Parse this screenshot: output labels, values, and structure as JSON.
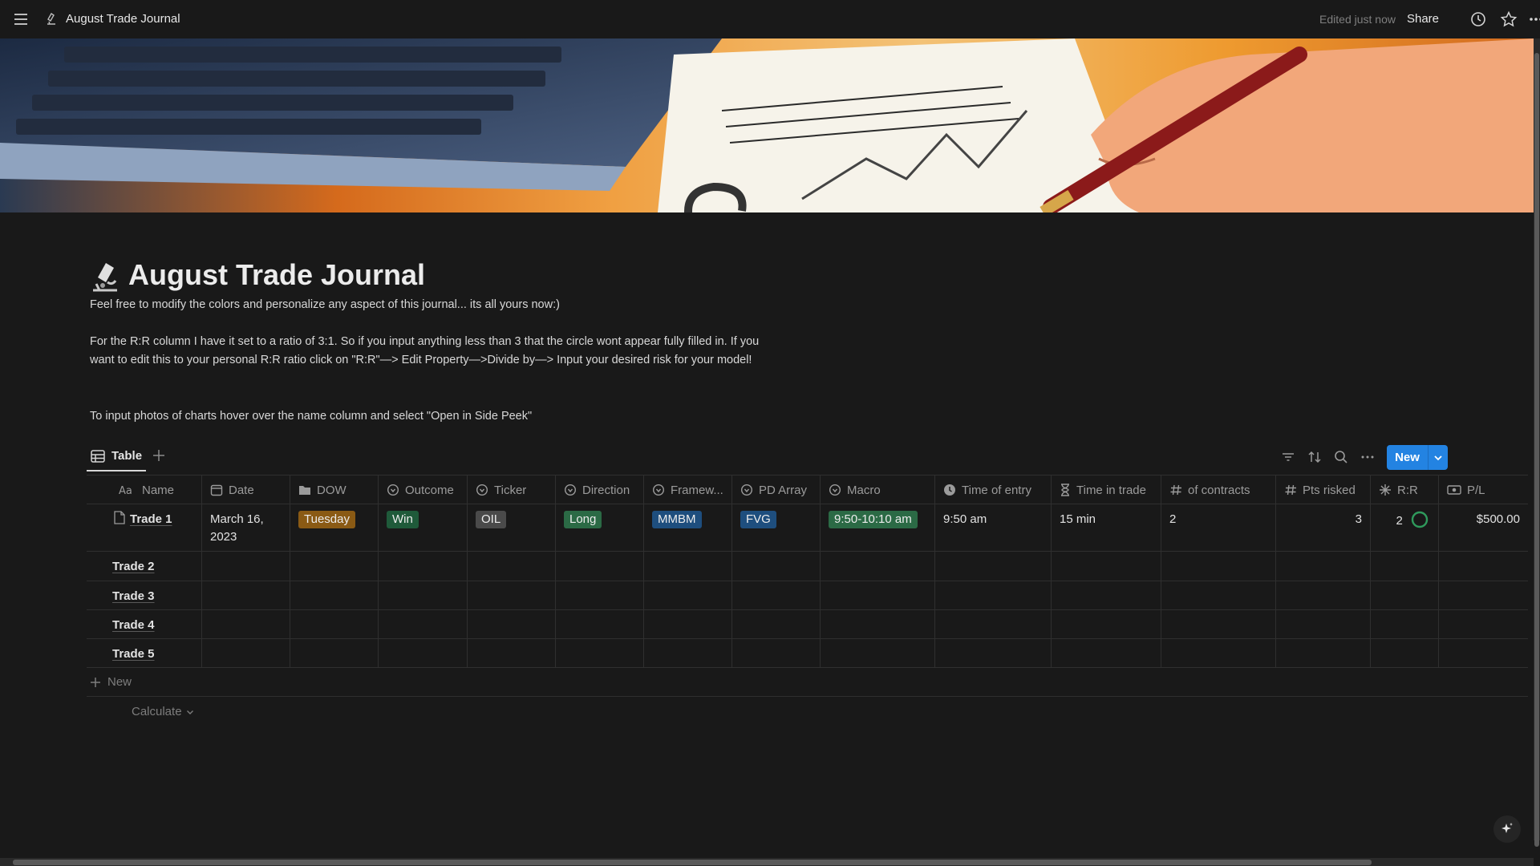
{
  "topbar": {
    "title": "August Trade Journal",
    "edited": "Edited just now",
    "share": "Share"
  },
  "page": {
    "title": "August Trade Journal",
    "desc": [
      "Feel free to modify the colors and personalize any aspect of this journal... its all yours now:)",
      "For the R:R column I have it set to a ratio of 3:1. So if you input anything less than 3 that the circle wont appear fully filled in. If you want to edit this to your personal R:R ratio click on \"R:R\"—> Edit Property—>Divide by—> Input your desired risk for your model!",
      "To input photos of charts hover over the name column and select \"Open in Side Peek\""
    ]
  },
  "view": {
    "tab_label": "Table",
    "new_label": "New"
  },
  "table": {
    "columns": [
      {
        "label": "Name",
        "icon": "text-aa-icon"
      },
      {
        "label": "Date",
        "icon": "calendar-icon"
      },
      {
        "label": "DOW",
        "icon": "folder-icon"
      },
      {
        "label": "Outcome",
        "icon": "status-icon"
      },
      {
        "label": "Ticker",
        "icon": "status-icon"
      },
      {
        "label": "Direction",
        "icon": "status-icon"
      },
      {
        "label": "Framew...",
        "icon": "status-icon"
      },
      {
        "label": "PD Array",
        "icon": "status-icon"
      },
      {
        "label": "Macro",
        "icon": "status-icon"
      },
      {
        "label": "Time of entry",
        "icon": "clock-icon"
      },
      {
        "label": "Time in trade",
        "icon": "hourglass-icon"
      },
      {
        "label": "of contracts",
        "icon": "hash-icon"
      },
      {
        "label": "Pts risked",
        "icon": "hash-icon"
      },
      {
        "label": "R:R",
        "icon": "formula-icon"
      },
      {
        "label": "P/L",
        "icon": "money-icon"
      }
    ],
    "rows": [
      {
        "name": "Trade 1",
        "date": "March 16, 2023",
        "dow": "Tuesday",
        "outcome": "Win",
        "ticker": "OIL",
        "direction": "Long",
        "framework": "MMBM",
        "pd_array": "FVG",
        "macro": "9:50-10:10 am",
        "time_of_entry": "9:50 am",
        "time_in_trade": "15 min",
        "contracts": "2",
        "pts_risked": "3",
        "rr": "2",
        "pl": "$500.00"
      },
      {
        "name": "Trade 2"
      },
      {
        "name": "Trade 3"
      },
      {
        "name": "Trade 4"
      },
      {
        "name": "Trade 5"
      }
    ],
    "new_row_label": "New",
    "calculate_label": "Calculate"
  },
  "colors": {
    "tag_tuesday": "#8a5a14",
    "tag_win": "#1f5a3a",
    "tag_oil": "#4a4a4a",
    "tag_long": "#2b6a45",
    "tag_mmbm": "#1e4e7e",
    "tag_fvg": "#1e4e7e",
    "tag_macro": "#2b6a45",
    "rr_ring": "#2f9a5c",
    "accent": "#2383e2"
  }
}
